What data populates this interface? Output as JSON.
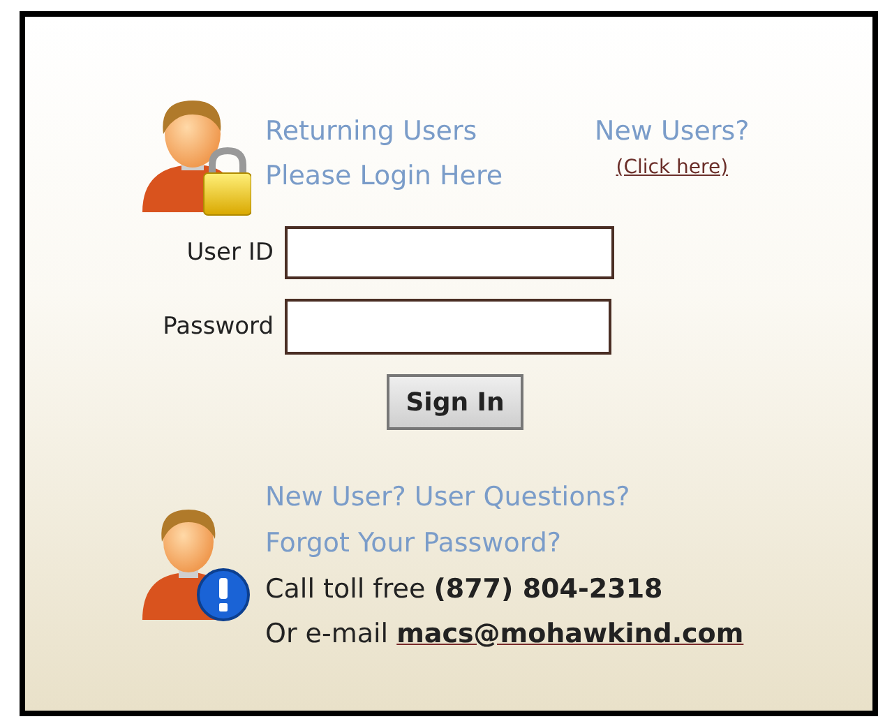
{
  "login": {
    "heading_lines": [
      "Returning Users",
      "Please Login Here"
    ],
    "new_users": {
      "title": "New Users?",
      "link": "(Click here)"
    },
    "fields": [
      {
        "label": "User ID",
        "kind": "text"
      },
      {
        "label": "Password",
        "kind": "password"
      }
    ],
    "button": "Sign In"
  },
  "help": {
    "links": [
      "New User? User Questions?",
      "Forgot Your Password?"
    ],
    "phone": "Call toll free **(877) 804-2318**",
    "email_prefix": "Or e-mail",
    "email": "macs@mohawkind.com"
  }
}
